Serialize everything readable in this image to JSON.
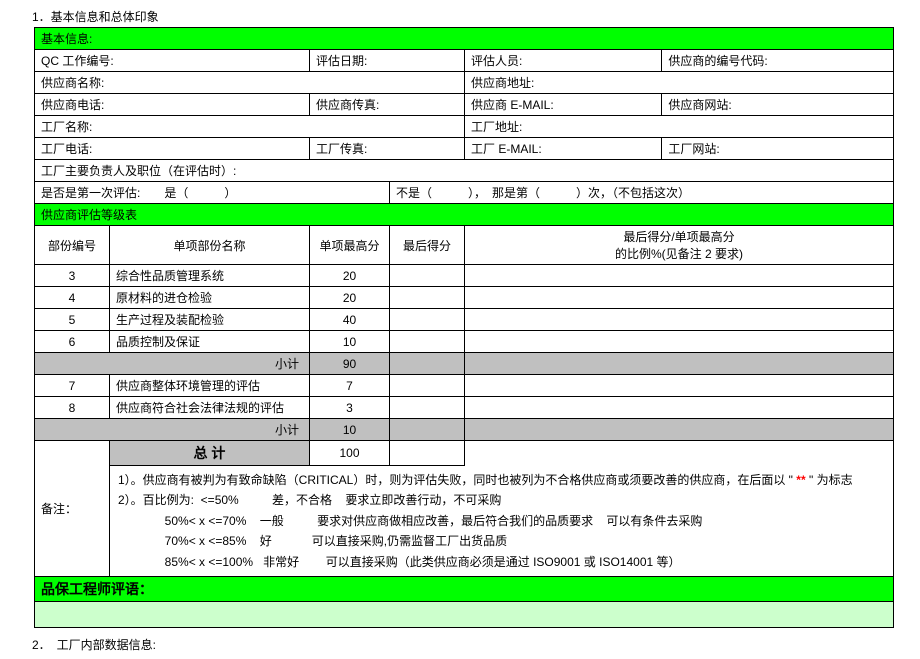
{
  "section1_title": "1．基本信息和总体印象",
  "basic_header": "基本信息:",
  "row1": {
    "c1": "QC 工作编号:",
    "c2": "评估日期:",
    "c3": "评估人员:",
    "c4": "供应商的编号代码:"
  },
  "row2": {
    "c1": "供应商名称:",
    "c2": "供应商地址:"
  },
  "row3": {
    "c1": "供应商电话:",
    "c2": "供应商传真:",
    "c3": "供应商 E-MAIL:",
    "c4": "供应商网站:"
  },
  "row4": {
    "c1": "工厂名称:",
    "c2": "工厂地址:"
  },
  "row5": {
    "c1": "工厂电话:",
    "c2": "工厂传真:",
    "c3": "工厂 E-MAIL:",
    "c4": "工厂网站:"
  },
  "row6": "工厂主要负责人及职位（在评估时）:",
  "row7": {
    "c1": "是否是第一次评估:　　是（　　　）",
    "c2": "不是（　　　），　那是第（　　　）次，（不包括这次）"
  },
  "grade_header": "供应商评估等级表",
  "th": {
    "a": "部份编号",
    "b": "单项部份名称",
    "c": "单项最高分",
    "d": "最后得分",
    "e": "最后得分/单项最高分\n的比例%(见备注 2 要求)"
  },
  "r": [
    {
      "a": "3",
      "b": "综合性品质管理系统",
      "c": "20"
    },
    {
      "a": "4",
      "b": "原材料的进仓检验",
      "c": "20"
    },
    {
      "a": "5",
      "b": "生产过程及装配检验",
      "c": "40"
    },
    {
      "a": "6",
      "b": "品质控制及保证",
      "c": "10"
    }
  ],
  "sub1": {
    "label": "小计",
    "val": "90"
  },
  "r2": [
    {
      "a": "7",
      "b": "供应商整体环境管理的评估",
      "c": "7"
    },
    {
      "a": "8",
      "b": "供应商符合社会法律法规的评估",
      "c": "3"
    }
  ],
  "sub2": {
    "label": "小计",
    "val": "10"
  },
  "total": {
    "label": "总 计",
    "val": "100"
  },
  "notes": {
    "title": "备注：",
    "line1a": "1）。供应商有被判为有致命缺陷（CRITICAL）时，则为评估失败，同时也被列为不合格供应商或须要改善的供应商，在后面以 \"",
    "line1_star": " ** ",
    "line1b": "\" 为标志",
    "line2": "2）。百比例为:  <=50%          差，不合格    要求立即改善行动，不可采购",
    "line3": "              50%< x <=70%    一般          要求对供应商做相应改善，最后符合我们的品质要求    可以有条件去采购",
    "line4": "              70%< x <=85%    好            可以直接采购,仍需监督工厂出货品质",
    "line5": "              85%< x <=100%   非常好        可以直接采购（此类供应商必须是通过 ISO9001 或 ISO14001 等）"
  },
  "comment_header": "品保工程师评语：",
  "section2_title": "2．　工厂内部数据信息:"
}
